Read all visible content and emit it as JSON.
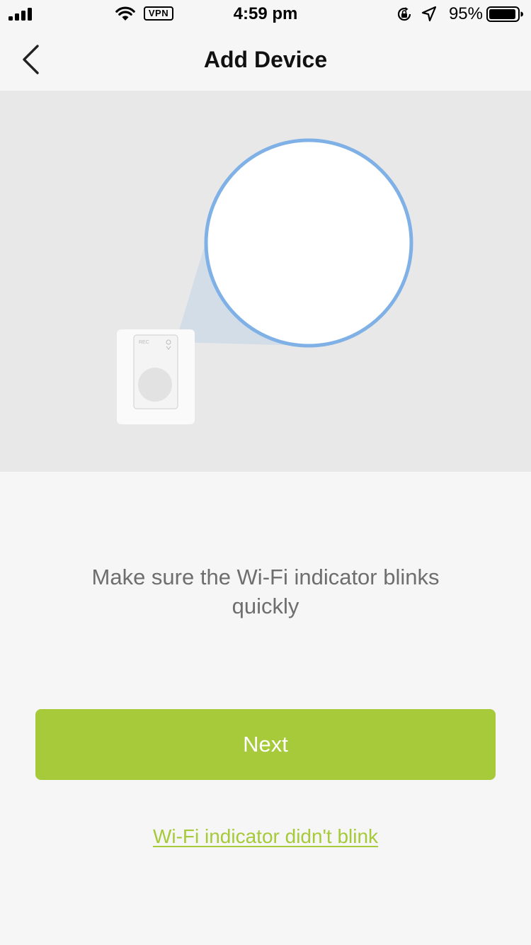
{
  "status_bar": {
    "time": "4:59 pm",
    "vpn_label": "VPN",
    "battery_percent": "95%",
    "battery_level": 0.95,
    "icons": [
      "signal-icon",
      "wifi-icon",
      "rotation-lock-icon",
      "location-icon",
      "battery-icon"
    ]
  },
  "nav": {
    "title": "Add Device",
    "back_icon": "chevron-left-icon"
  },
  "illustration": {
    "device_label": "REC",
    "accent_color": "#7fb0e6"
  },
  "main": {
    "instruction": "Make sure the Wi-Fi indicator blinks quickly",
    "next_label": "Next",
    "help_link": "Wi-Fi indicator didn't blink"
  },
  "colors": {
    "primary": "#a6ca39",
    "background": "#f6f6f6",
    "illustration_bg": "#e8e8e8",
    "text_muted": "#6e6e6e"
  }
}
